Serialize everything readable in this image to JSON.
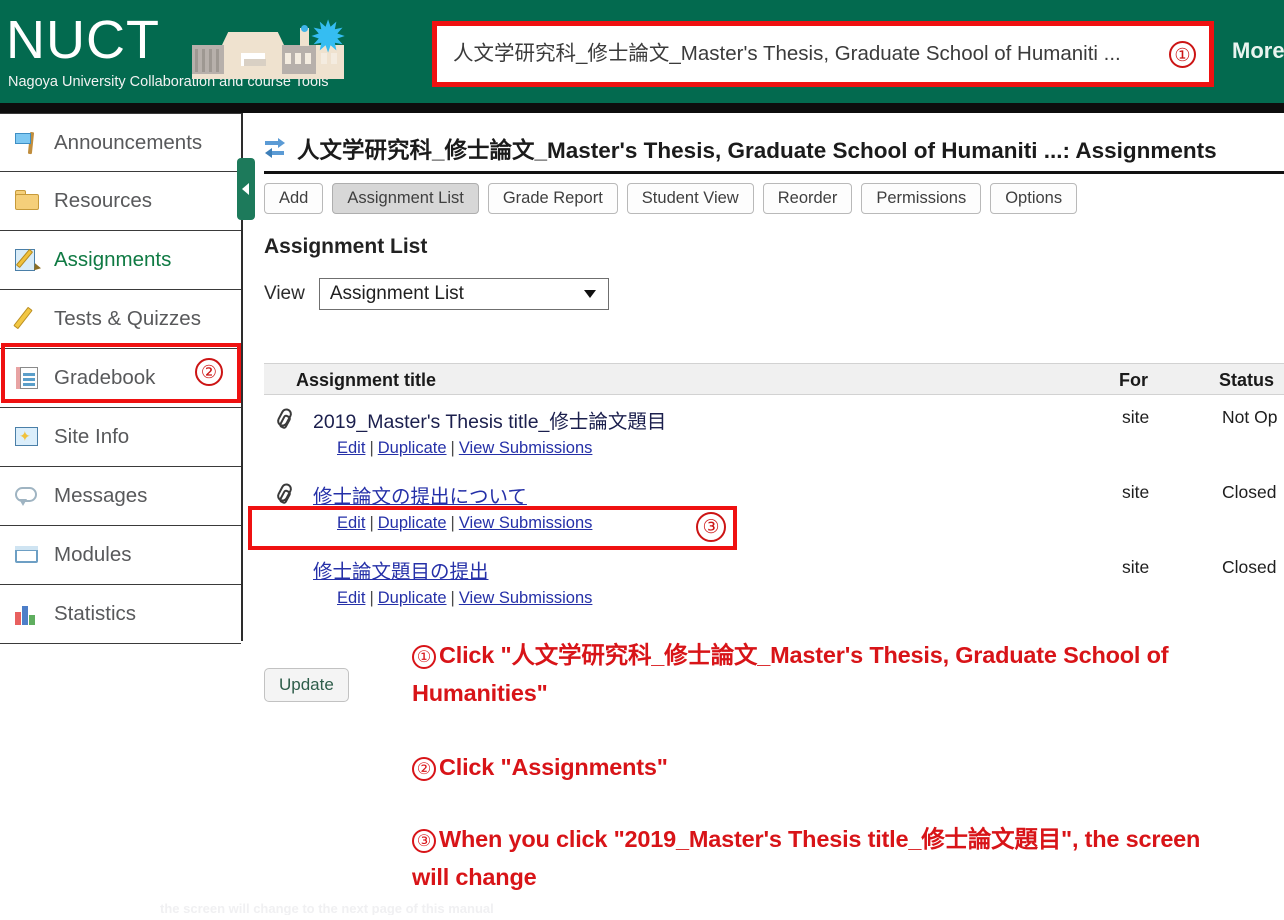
{
  "header": {
    "logo_title": "NUCT",
    "logo_tagline": "Nagoya University Collaboration and course Tools",
    "site_tab_label": "人文学研究科_修士論文_Master's Thesis, Graduate School of Humaniti ...",
    "site_tab_marker": "①",
    "more_link": "More",
    "bg_color": "#036a4f",
    "highlight_color": "#ef1111"
  },
  "sidebar": {
    "items": [
      {
        "label": "Announcements",
        "icon": "flag-icon",
        "active": false
      },
      {
        "label": "Resources",
        "icon": "folder-icon",
        "active": false
      },
      {
        "label": "Assignments",
        "icon": "assignment-sheet-pencil-icon",
        "active": true
      },
      {
        "label": "Tests & Quizzes",
        "icon": "pencil-icon",
        "active": false
      },
      {
        "label": "Gradebook",
        "icon": "gradebook-icon",
        "active": false
      },
      {
        "label": "Site Info",
        "icon": "site-info-icon",
        "active": false
      },
      {
        "label": "Messages",
        "icon": "speech-bubble-icon",
        "active": false
      },
      {
        "label": "Modules",
        "icon": "window-icon",
        "active": false
      },
      {
        "label": "Statistics",
        "icon": "bar-chart-icon",
        "active": false
      }
    ],
    "assignments_marker": "②",
    "collapse_handle_icon": "chevron-left-icon"
  },
  "main": {
    "page_title": "人文学研究科_修士論文_Master's Thesis, Graduate School of Humaniti ...: Assignments",
    "refresh_icon": "refresh-icon",
    "toolbar": [
      {
        "label": "Add",
        "active": false
      },
      {
        "label": "Assignment List",
        "active": true
      },
      {
        "label": "Grade Report",
        "active": false
      },
      {
        "label": "Student View",
        "active": false
      },
      {
        "label": "Reorder",
        "active": false
      },
      {
        "label": "Permissions",
        "active": false
      },
      {
        "label": "Options",
        "active": false
      }
    ],
    "section_title": "Assignment List",
    "view": {
      "label": "View",
      "selected": "Assignment List",
      "options": [
        "Assignment List"
      ]
    },
    "table": {
      "columns": [
        "Assignment title",
        "For",
        "Status"
      ],
      "rows": [
        {
          "title": "2019_Master's Thesis title_修士論文題目",
          "has_attachment": true,
          "underlined": false,
          "marker": "③",
          "for": "site",
          "status": "Not Op",
          "actions": [
            "Edit",
            "Duplicate",
            "View Submissions"
          ]
        },
        {
          "title": "修士論文の提出について",
          "has_attachment": true,
          "underlined": true,
          "marker": "",
          "for": "site",
          "status": "Closed",
          "actions": [
            "Edit",
            "Duplicate",
            "View Submissions"
          ]
        },
        {
          "title": "修士論文題目の提出",
          "has_attachment": false,
          "underlined": true,
          "marker": "",
          "for": "site",
          "status": "Closed",
          "actions": [
            "Edit",
            "Duplicate",
            "View Submissions"
          ]
        }
      ]
    },
    "update_button": "Update"
  },
  "annotations": {
    "color": "#d81418",
    "step1_num": "①",
    "step1_text": "Click \"人文学研究科_修士論文_Master's Thesis, Graduate School of Humanities\"",
    "step2_num": "②",
    "step2_text": "Click \"Assignments\"",
    "step3_num": "③",
    "step3_text": "When you click \"2019_Master's Thesis title_修士論文題目\", the screen will change",
    "cutoff_line": "the screen will change to the next page of this manual"
  }
}
